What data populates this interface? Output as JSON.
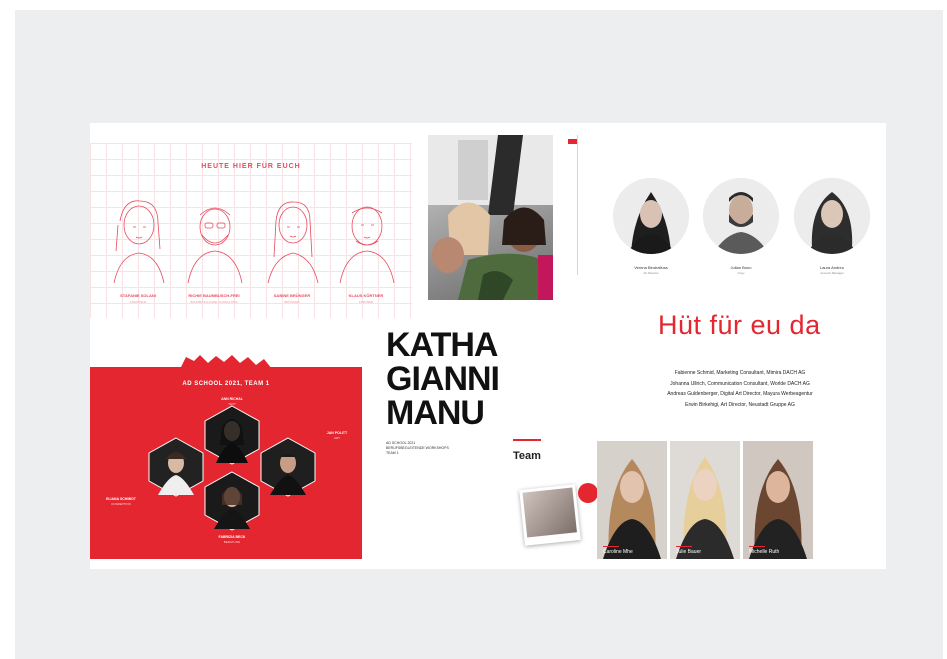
{
  "sketch": {
    "title": "HEUTE HIER FÜR EUCH",
    "people": [
      {
        "name": "STAFANIE SOLANI",
        "role": "ASSISTENZ"
      },
      {
        "name": "RICHIE BAUMBUSCH-FREI",
        "role": "BAUMBUSCH-FREI CONSULTING"
      },
      {
        "name": "SABINE BRÜNGER",
        "role": "BRÜNGER"
      },
      {
        "name": "KLAUS KÖRTNER",
        "role": "KÖRTNER"
      }
    ]
  },
  "right_top": {
    "people": [
      {
        "name": "Verena Bindrafluss",
        "role": "Art Director"
      },
      {
        "name": "Julian Bono",
        "role": "Copy"
      },
      {
        "name": "Laura Andreu",
        "role": "Account Manager"
      }
    ],
    "headline": "Hüt für eu da",
    "credits": [
      "Fabienne Schmid, Marketing Consultant, Mimira DACH AG",
      "Johanna Ullrich, Communication Consultant, Worlde DACH AG",
      "Andreas Guldenberger, Digital Art Director, Mayura Werbeagentur",
      "Erwin Birkehigi, Art Director, Neustadt Gruppe AG"
    ]
  },
  "names": {
    "lines": [
      "KATHA",
      "GIANNI",
      "MANU"
    ],
    "small": [
      "AD SCHOOL 2021",
      "BERUFSBEGLEITENDE WORKSHOPS",
      "TEAM 1"
    ]
  },
  "redpanel": {
    "title": "AD SCHOOL 2021, TEAM 1",
    "members": [
      {
        "name": "ANN RICHAL",
        "role": "TEXT"
      },
      {
        "name": "JAN POLITT",
        "role": "ART"
      },
      {
        "name": "ELIANA SCHMIDT",
        "role": "KONZEPTION"
      },
      {
        "name": "FABRIZIA BECK",
        "role": "BERATUNG"
      }
    ]
  },
  "team": {
    "label": "Team",
    "members": [
      {
        "name": "Caroline Mhe"
      },
      {
        "name": "Julie Bauer"
      },
      {
        "name": "Michelle Ruth"
      }
    ]
  },
  "colors": {
    "accent": "#e3262f",
    "sketch": "#e84b5e",
    "frame": "#edeef0"
  }
}
